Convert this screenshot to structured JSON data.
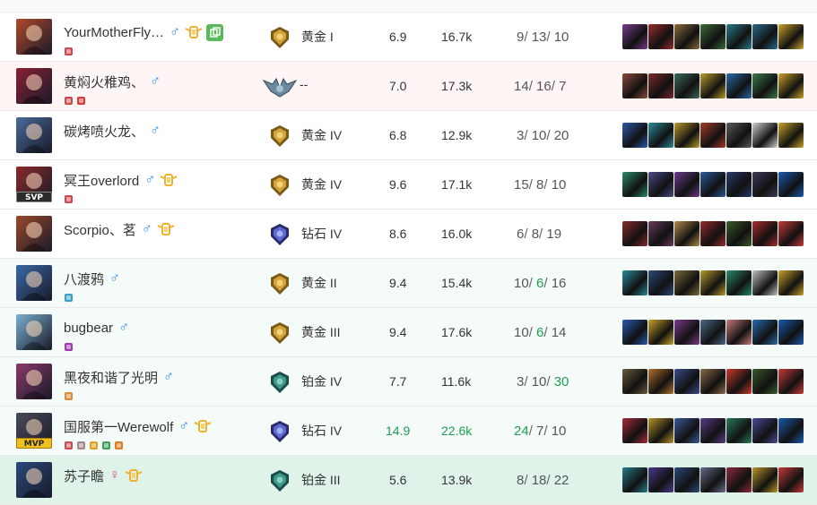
{
  "rows": [
    {
      "name": "YourMotherFly…",
      "sex": "m",
      "honor": true,
      "copy": true,
      "badges": [
        "gold-e"
      ],
      "rank": "黄金 I",
      "rank_tier": "gold",
      "score": "6.9",
      "damage": "16.7k",
      "k": "9",
      "d": "13",
      "a": "10",
      "highlight": {},
      "bg": "plain",
      "avatar_color": "#b04a2a",
      "avatar_tag": "",
      "items": [
        "#7a3b8c",
        "#9b2a2a",
        "#8a6a3a",
        "#3d6b3a",
        "#2a7a8a",
        "#2a6a8a",
        "#c9a32a"
      ]
    },
    {
      "name": "黄焖火稚鸡、",
      "sex": "m",
      "honor": false,
      "copy": false,
      "badges": [
        "gold-e",
        "red-god"
      ],
      "rank": "--",
      "rank_tier": "unranked",
      "score": "7.0",
      "damage": "17.3k",
      "k": "14",
      "d": "16",
      "a": "7",
      "highlight": {},
      "bg": "red",
      "avatar_color": "#8a2035",
      "avatar_tag": "",
      "items": [
        "#8a4a3a",
        "#7a2a2a",
        "#3a6a5a",
        "#b89a2a",
        "#2a6aa8",
        "#3a7a4a",
        "#c9a32a"
      ]
    },
    {
      "name": "碳烤喷火龙、",
      "sex": "m",
      "honor": false,
      "copy": false,
      "badges": [],
      "rank": "黄金 IV",
      "rank_tier": "gold",
      "score": "6.8",
      "damage": "12.9k",
      "k": "3",
      "d": "10",
      "a": "20",
      "highlight": {},
      "bg": "plain",
      "avatar_color": "#4a6a9a",
      "avatar_tag": "",
      "items": [
        "#2a5aa8",
        "#2a8a9a",
        "#b89a2a",
        "#a83a2a",
        "#5a5a5a",
        "#d0d0d0",
        "#c9a32a"
      ]
    },
    {
      "name": "冥王overlord",
      "sex": "m",
      "honor": true,
      "copy": false,
      "badges": [
        "gold-e"
      ],
      "rank": "黄金 IV",
      "rank_tier": "gold",
      "score": "9.6",
      "damage": "17.1k",
      "k": "15",
      "d": "8",
      "a": "10",
      "highlight": {},
      "bg": "plain",
      "avatar_color": "#8a2a2a",
      "avatar_tag": "SVP",
      "items": [
        "#2a8a6a",
        "#4a4a8a",
        "#6a3a8a",
        "#2a5a9a",
        "#2a3a6a",
        "#3a3a5a",
        "#1a5ab0"
      ]
    },
    {
      "name": "Scorpio、茗",
      "sex": "m",
      "honor": true,
      "copy": false,
      "badges": [],
      "rank": "钻石 IV",
      "rank_tier": "diamond",
      "score": "8.6",
      "damage": "16.0k",
      "k": "6",
      "d": "8",
      "a": "19",
      "highlight": {},
      "bg": "plain",
      "avatar_color": "#9a4a2a",
      "avatar_tag": "",
      "items": [
        "#8a2a2a",
        "#6a3a5a",
        "#b08a4a",
        "#9a2a2a",
        "#3a5a2a",
        "#a82a2a",
        "#c83a3a"
      ]
    },
    {
      "name": "八渡鸦",
      "sex": "m",
      "honor": false,
      "copy": false,
      "badges": [
        "teal-e"
      ],
      "rank": "黄金 II",
      "rank_tier": "gold",
      "score": "9.4",
      "damage": "15.4k",
      "k": "10",
      "d": "6",
      "a": "16",
      "highlight": {
        "d": true
      },
      "bg": "green",
      "avatar_color": "#3a6aa8",
      "avatar_tag": "",
      "items": [
        "#2a8a9a",
        "#2a4a7a",
        "#7a6a3a",
        "#b89a2a",
        "#2a8a6a",
        "#c0c0c0",
        "#c9a32a"
      ]
    },
    {
      "name": "bugbear",
      "sex": "m",
      "honor": false,
      "copy": false,
      "badges": [
        "purple-e"
      ],
      "rank": "黄金 III",
      "rank_tier": "gold",
      "score": "9.4",
      "damage": "17.6k",
      "k": "10",
      "d": "6",
      "a": "14",
      "highlight": {
        "d": true
      },
      "bg": "green",
      "avatar_color": "#7ab0d0",
      "avatar_tag": "",
      "items": [
        "#2a5ab0",
        "#c9a32a",
        "#7a3a8a",
        "#4a6a8a",
        "#c87a7a",
        "#2a6ab0",
        "#1a5ab0"
      ]
    },
    {
      "name": "黑夜和谐了光明",
      "sex": "m",
      "honor": false,
      "copy": false,
      "badges": [
        "orange-e"
      ],
      "rank": "铂金 IV",
      "rank_tier": "platinum",
      "score": "7.7",
      "damage": "11.6k",
      "k": "3",
      "d": "10",
      "a": "30",
      "highlight": {
        "a": true
      },
      "bg": "green",
      "avatar_color": "#8a3a6a",
      "avatar_tag": "",
      "items": [
        "#6a5a3a",
        "#b0702a",
        "#3a4a8a",
        "#8a6a4a",
        "#c83a2a",
        "#3a5a2a",
        "#c83a3a"
      ]
    },
    {
      "name": "国服第一Werewolf",
      "sex": "m",
      "honor": true,
      "copy": false,
      "badges": [
        "red-e",
        "grey-e",
        "gold-o",
        "green-o",
        "orange-h"
      ],
      "rank": "钻石 IV",
      "rank_tier": "diamond",
      "score": "14.9",
      "damage": "22.6k",
      "k": "24",
      "d": "7",
      "a": "10",
      "highlight": {
        "score": true,
        "damage": true,
        "k": true
      },
      "bg": "green",
      "avatar_color": "#4a4a5a",
      "avatar_tag": "MVP",
      "items": [
        "#a82a3a",
        "#b8942a",
        "#3a5a9a",
        "#5a3a8a",
        "#2a7a5a",
        "#4a4a9a",
        "#1a5ab0"
      ]
    },
    {
      "name": "苏子瞻",
      "sex": "f",
      "honor": true,
      "copy": false,
      "badges": [],
      "rank": "铂金 III",
      "rank_tier": "platinum",
      "score": "5.6",
      "damage": "13.9k",
      "k": "8",
      "d": "18",
      "a": "22",
      "highlight": {},
      "bg": "self",
      "avatar_color": "#2a4a7a",
      "avatar_tag": "",
      "items": [
        "#2a7a8a",
        "#4a3a8a",
        "#2a4a7a",
        "#6a6a8a",
        "#8a2a3a",
        "#b8942a",
        "#c83a3a"
      ]
    }
  ],
  "sex_symbols": {
    "m": "♂",
    "f": "♀"
  },
  "kda_sep": "/"
}
